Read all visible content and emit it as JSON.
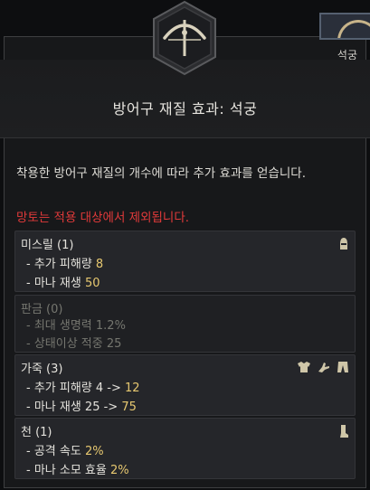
{
  "weapon_type": "석궁",
  "title": "방어구 재질 효과: 석궁",
  "description": "착용한 방어구 재질의 개수에 따라 추가 효과를 얻습니다.",
  "warning": "망토는 적용 대상에서 제외됩니다.",
  "colors": {
    "warning": "#e23a3a",
    "highlight": "#e7c870",
    "inactive": "#75766f"
  },
  "materials": [
    {
      "name": "미스릴 (1)",
      "active": true,
      "icons": [
        "helmet-icon"
      ],
      "effects": [
        {
          "text": "- 추가 피해량 ",
          "value": "8"
        },
        {
          "text": "- 마나 재생 ",
          "value": "50"
        }
      ]
    },
    {
      "name": "판금 (0)",
      "active": false,
      "icons": [],
      "effects": [
        {
          "text": "- 최대 생명력 ",
          "value": "1.2%"
        },
        {
          "text": "- 상태이상 적중 ",
          "value": "25"
        }
      ]
    },
    {
      "name": "가죽 (3)",
      "active": true,
      "icons": [
        "chest-armor-icon",
        "gloves-icon",
        "pants-icon"
      ],
      "effects": [
        {
          "text": "- 추가 피해량 4 -> ",
          "value": "12"
        },
        {
          "text": "- 마나 재생 25 -> ",
          "value": "75"
        }
      ]
    },
    {
      "name": "천 (1)",
      "active": true,
      "icons": [
        "boots-icon"
      ],
      "effects": [
        {
          "text": "- 공격 속도 ",
          "value": "2%"
        },
        {
          "text": "- 마나 소모 효율 ",
          "value": "2%"
        }
      ]
    }
  ]
}
